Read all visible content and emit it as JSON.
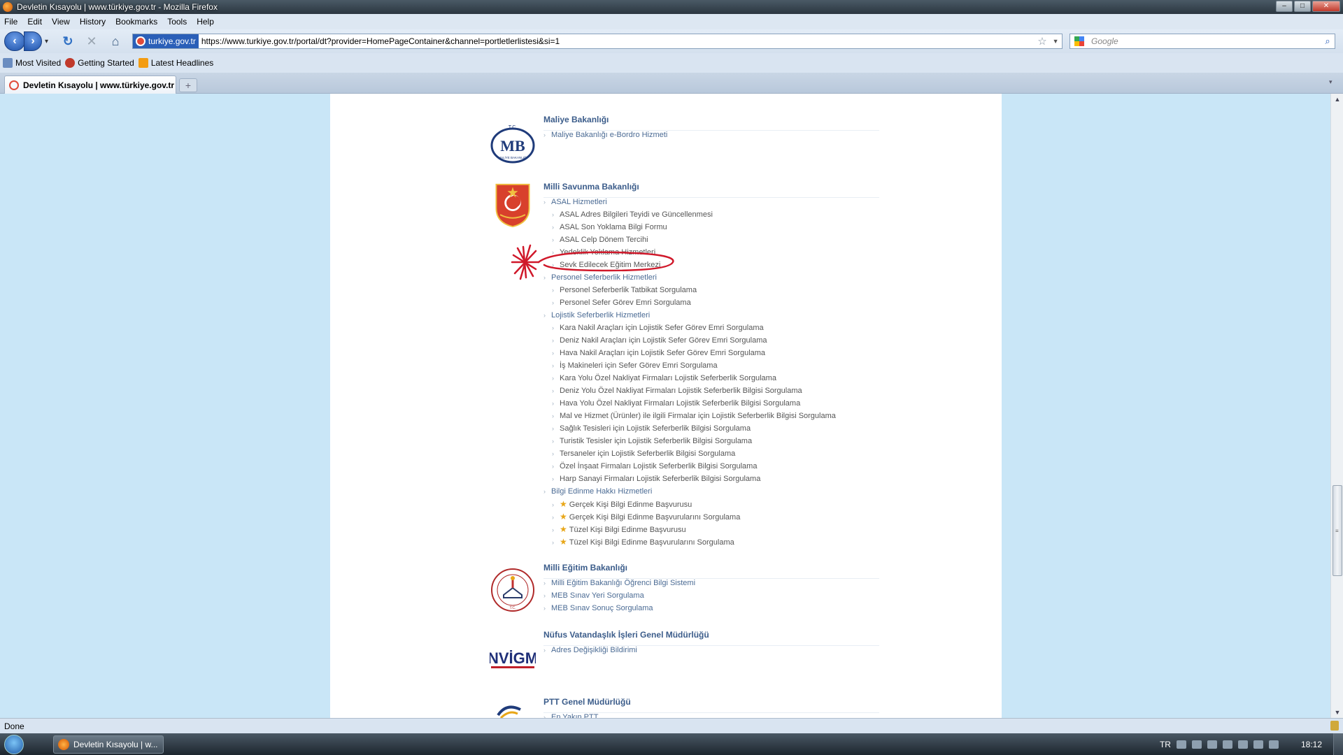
{
  "window": {
    "title": "Devletin Kısayolu | www.türkiye.gov.tr - Mozilla Firefox",
    "controls": [
      "–",
      "□",
      "✕"
    ]
  },
  "menubar": {
    "items": [
      "File",
      "Edit",
      "View",
      "History",
      "Bookmarks",
      "Tools",
      "Help"
    ]
  },
  "navbar": {
    "identity_label": "turkiye.gov.tr",
    "url": "https://www.turkiye.gov.tr/portal/dt?provider=HomePageContainer&channel=portletlerlistesi&si=1",
    "search_placeholder": "Google"
  },
  "bookmarks": {
    "items": [
      "Most Visited",
      "Getting Started",
      "Latest Headlines"
    ]
  },
  "tabs": {
    "active_title": "Devletin Kısayolu | www.türkiye.gov.tr",
    "new_tab": "+"
  },
  "sections": [
    {
      "title": "Maliye Bakanlığı",
      "items": [
        {
          "label": "Maliye Bakanlığı e-Bordro Hizmeti",
          "level": 0
        }
      ]
    },
    {
      "title": "Milli Savunma Bakanlığı",
      "items": [
        {
          "label": "ASAL Hizmetleri",
          "level": 0
        },
        {
          "label": "ASAL Adres Bilgileri Teyidi ve Güncellenmesi",
          "level": 1
        },
        {
          "label": "ASAL Son Yoklama Bilgi Formu",
          "level": 1
        },
        {
          "label": "ASAL Celp Dönem Tercihi",
          "level": 1
        },
        {
          "label": "Yedeklik Yoklama Hizmetleri",
          "level": 1
        },
        {
          "label": "Sevk Edilecek Eğitim Merkezi",
          "level": 1
        },
        {
          "label": "Personel Seferberlik Hizmetleri",
          "level": 0
        },
        {
          "label": "Personel Seferberlik Tatbikat Sorgulama",
          "level": 1
        },
        {
          "label": "Personel Sefer Görev Emri Sorgulama",
          "level": 1
        },
        {
          "label": "Lojistik Seferberlik Hizmetleri",
          "level": 0
        },
        {
          "label": "Kara Nakil Araçları için Lojistik Sefer Görev Emri Sorgulama",
          "level": 1
        },
        {
          "label": "Deniz Nakil Araçları için Lojistik Sefer Görev Emri Sorgulama",
          "level": 1
        },
        {
          "label": "Hava Nakil Araçları için Lojistik Sefer Görev Emri Sorgulama",
          "level": 1
        },
        {
          "label": "İş Makineleri için Sefer Görev Emri Sorgulama",
          "level": 1
        },
        {
          "label": "Kara Yolu Özel Nakliyat Firmaları Lojistik Seferberlik Sorgulama",
          "level": 1
        },
        {
          "label": "Deniz Yolu Özel Nakliyat Firmaları Lojistik Seferberlik Bilgisi Sorgulama",
          "level": 1
        },
        {
          "label": "Hava Yolu Özel Nakliyat Firmaları Lojistik Seferberlik Bilgisi Sorgulama",
          "level": 1
        },
        {
          "label": "Mal ve Hizmet (Ürünler) ile ilgili Firmalar için Lojistik Seferberlik Bilgisi Sorgulama",
          "level": 1
        },
        {
          "label": "Sağlık Tesisleri için Lojistik Seferberlik Bilgisi Sorgulama",
          "level": 1
        },
        {
          "label": "Turistik Tesisler için Lojistik Seferberlik Bilgisi Sorgulama",
          "level": 1
        },
        {
          "label": "Tersaneler için Lojistik Seferberlik Bilgisi Sorgulama",
          "level": 1
        },
        {
          "label": "Özel İnşaat Firmaları Lojistik Seferberlik Bilgisi Sorgulama",
          "level": 1
        },
        {
          "label": "Harp Sanayi Firmaları Lojistik Seferberlik Bilgisi Sorgulama",
          "level": 1
        },
        {
          "label": "Bilgi Edinme Hakkı Hizmetleri",
          "level": 0
        },
        {
          "label": "Gerçek Kişi Bilgi Edinme Başvurusu",
          "level": 1,
          "star": true
        },
        {
          "label": "Gerçek Kişi Bilgi Edinme Başvurularını Sorgulama",
          "level": 1,
          "star": true
        },
        {
          "label": "Tüzel Kişi Bilgi Edinme Başvurusu",
          "level": 1,
          "star": true
        },
        {
          "label": "Tüzel Kişi Bilgi Edinme Başvurularını Sorgulama",
          "level": 1,
          "star": true
        }
      ]
    },
    {
      "title": "Milli Eğitim Bakanlığı",
      "items": [
        {
          "label": "Milli Eğitim Bakanlığı Öğrenci Bilgi Sistemi",
          "level": 0
        },
        {
          "label": "MEB Sınav Yeri Sorgulama",
          "level": 0
        },
        {
          "label": "MEB Sınav Sonuç Sorgulama",
          "level": 0
        }
      ]
    },
    {
      "title": "Nüfus Vatandaşlık İşleri Genel Müdürlüğü",
      "items": [
        {
          "label": "Adres Değişikliği Bildirimi",
          "level": 0
        }
      ]
    },
    {
      "title": "PTT Genel Müdürlüğü",
      "items": [
        {
          "label": "En Yakın PTT",
          "level": 0
        }
      ]
    }
  ],
  "logos": {
    "maliye": "T.C. MB MALİYE BAKANLIĞI",
    "nvigm": "NVİGM"
  },
  "statusbar": {
    "text": "Done"
  },
  "taskbar": {
    "item_label": "Devletin Kısayolu | w...",
    "lang": "TR",
    "clock": "18:12"
  },
  "colors": {
    "page_bg": "#c9e6f7",
    "link": "#4b6b94",
    "heading": "#3b5c8a",
    "annotation": "#d0182a"
  }
}
